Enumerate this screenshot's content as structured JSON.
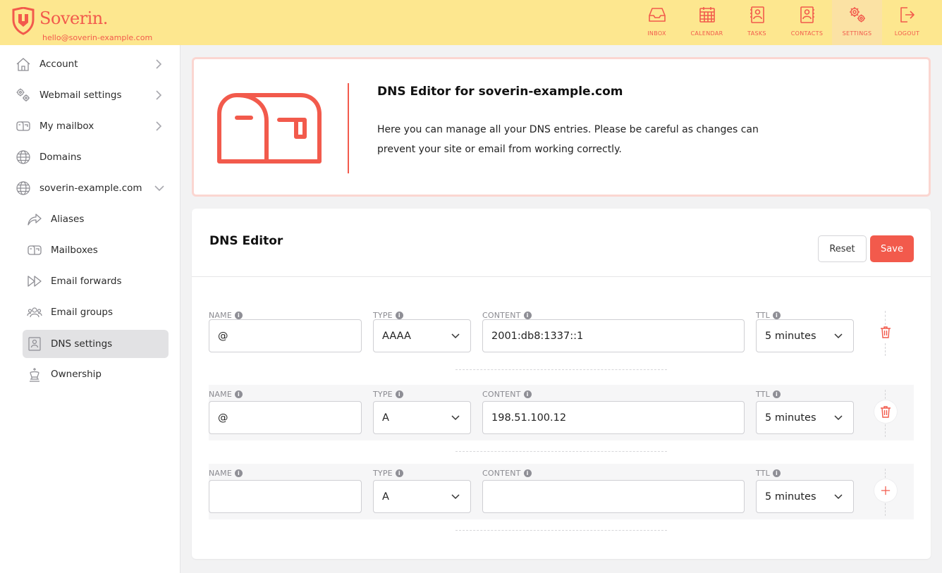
{
  "brand": {
    "name": "Soverin.",
    "email": "hello@soverin-example.com"
  },
  "nav": [
    {
      "label": "INBOX",
      "icon": "inbox-icon"
    },
    {
      "label": "CALENDAR",
      "icon": "calendar-icon"
    },
    {
      "label": "TASKS",
      "icon": "tasks-icon"
    },
    {
      "label": "CONTACTS",
      "icon": "contacts-icon"
    },
    {
      "label": "SETTINGS",
      "icon": "settings-icon",
      "active": true
    },
    {
      "label": "LOGOUT",
      "icon": "logout-icon"
    }
  ],
  "sidebar": {
    "items": [
      {
        "label": "Account",
        "icon": "home-icon",
        "chevron": "right"
      },
      {
        "label": "Webmail settings",
        "icon": "gears-icon",
        "chevron": "right"
      },
      {
        "label": "My mailbox",
        "icon": "mailbox-icon",
        "chevron": "right"
      },
      {
        "label": "Domains",
        "icon": "globe-icon"
      },
      {
        "label": "soverin-example.com",
        "icon": "globe-icon",
        "chevron": "down"
      },
      {
        "label": "Aliases",
        "icon": "forward-arrow-icon"
      },
      {
        "label": "Mailboxes",
        "icon": "mailbox-icon"
      },
      {
        "label": "Email forwards",
        "icon": "fast-forward-icon"
      },
      {
        "label": "Email groups",
        "icon": "users-icon"
      },
      {
        "label": "DNS settings",
        "icon": "dns-card-icon",
        "selected": true
      },
      {
        "label": "Ownership",
        "icon": "chess-king-icon"
      }
    ]
  },
  "info": {
    "title": "DNS Editor for soverin-example.com",
    "text": "Here you can manage all your DNS entries. Please be careful as changes can prevent your site or email from working correctly."
  },
  "editor": {
    "title": "DNS Editor",
    "reset_label": "Reset",
    "save_label": "Save",
    "labels": {
      "name": "NAME",
      "type": "TYPE",
      "content": "CONTENT",
      "ttl": "TTL"
    },
    "rows": [
      {
        "name": "@",
        "type": "AAAA",
        "content": "2001:db8:1337::1",
        "ttl": "5 minutes",
        "action": "delete"
      },
      {
        "name": "@",
        "type": "A",
        "content": "198.51.100.12",
        "ttl": "5 minutes",
        "action": "delete"
      },
      {
        "name": "",
        "type": "A",
        "content": "",
        "ttl": "5 minutes",
        "action": "add"
      }
    ]
  },
  "colors": {
    "accent": "#f25a4c",
    "topbar": "#fde78f",
    "selected": "#e2e2e4"
  }
}
